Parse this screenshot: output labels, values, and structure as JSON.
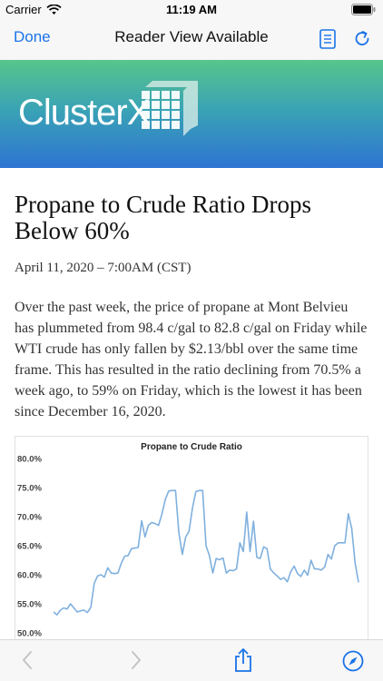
{
  "status": {
    "carrier": "Carrier",
    "time": "11:19 AM"
  },
  "nav": {
    "done_label": "Done",
    "title": "Reader View Available"
  },
  "banner": {
    "logo_text": "ClusterX"
  },
  "article": {
    "title": "Propane to Crude Ratio Drops Below 60%",
    "date": "April 11, 2020 – 7:00AM (CST)",
    "body": "Over the past week, the price of propane at Mont Belvieu has plummeted from 98.4 c/gal to 82.8 c/gal on Friday while WTI crude has only fallen by $2.13/bbl over the same time frame. This has resulted in the ratio declining from 70.5% a week ago, to 59% on Friday, which is the lowest it has been since December 16, 2020."
  },
  "colors": {
    "accent": "#1a73e8",
    "line": "#7fb0de",
    "banner_top": "#58c58c",
    "banner_bottom": "#2d74d2"
  },
  "icons": {
    "reader": "reader-view-icon",
    "reload": "reload-icon",
    "back": "chevron-left-icon",
    "forward": "chevron-right-icon",
    "share": "share-icon",
    "safari": "compass-icon"
  },
  "chart_data": {
    "type": "line",
    "title": "Propane to Crude Ratio",
    "ylim": [
      50,
      80
    ],
    "y_ticks": [
      "80.0%",
      "75.0%",
      "70.0%",
      "65.0%",
      "60.0%",
      "55.0%",
      "50.0%"
    ],
    "grid": false,
    "series": [
      {
        "values": [
          53.6,
          53.1,
          53.9,
          54.3,
          54.1,
          55.0,
          54.3,
          53.6,
          53.8,
          53.9,
          53.5,
          54.4,
          58.5,
          59.8,
          60.0,
          59.6,
          61.2,
          60.3,
          60.2,
          60.3,
          62.0,
          63.2,
          63.3,
          64.5,
          64.6,
          64.7,
          69.3,
          66.5,
          68.5,
          69.0,
          68.8,
          68.5,
          70.5,
          73.0,
          74.4,
          74.5,
          74.5,
          67.2,
          63.5,
          66.5,
          67.5,
          71.5,
          74.3,
          74.5,
          74.5,
          65.0,
          63.3,
          60.3,
          62.8,
          62.6,
          62.9,
          60.3,
          60.8,
          60.7,
          61.0,
          65.5,
          64.0,
          70.8,
          64.0,
          69.2,
          63.0,
          62.8,
          64.8,
          64.5,
          61.0,
          60.3,
          59.8,
          59.2,
          59.5,
          58.8,
          60.5,
          61.5,
          60.2,
          59.7,
          60.8,
          59.9,
          62.5,
          61.0,
          61.0,
          60.8,
          61.3,
          63.5,
          62.7,
          65.0,
          65.5,
          65.5,
          65.5,
          70.5,
          68.0,
          62.0,
          58.7
        ]
      }
    ]
  }
}
